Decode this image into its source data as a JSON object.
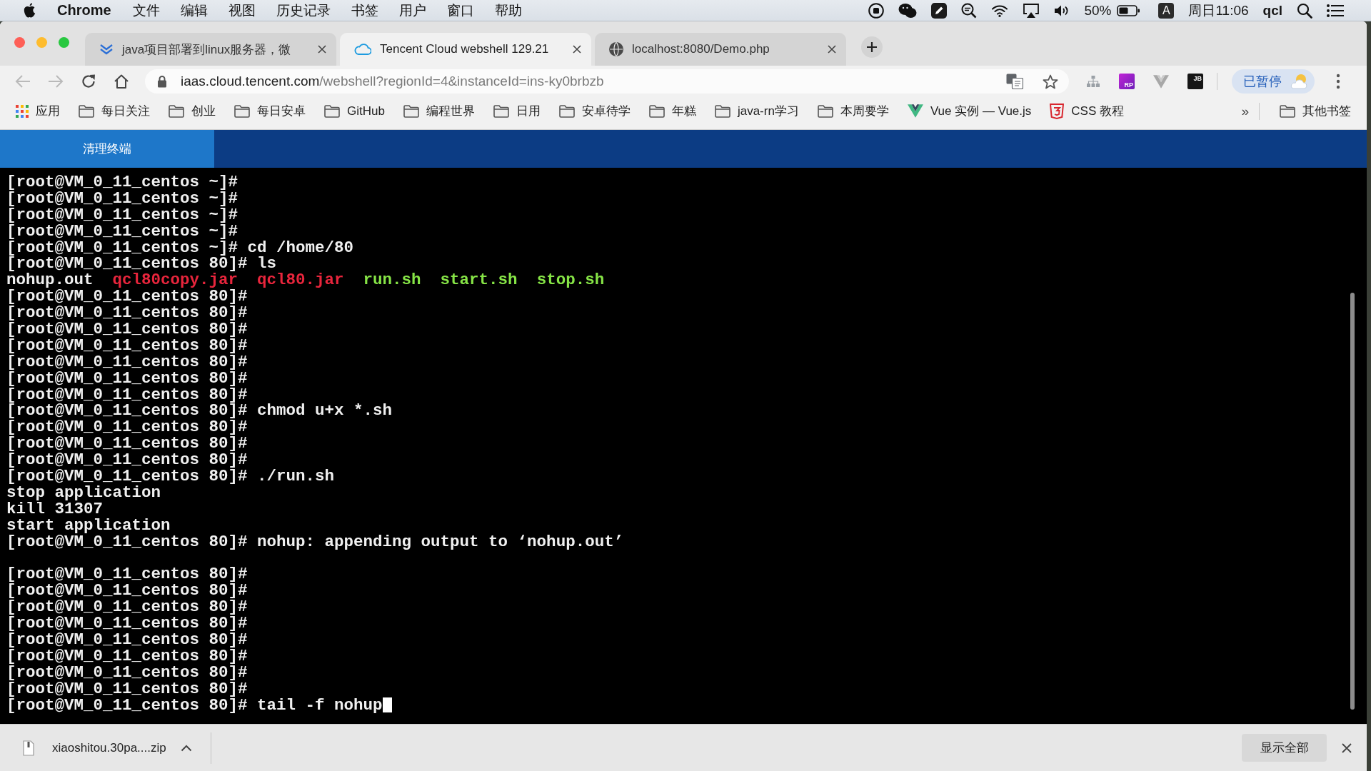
{
  "menu_bar": {
    "app_name": "Chrome",
    "menus": [
      "文件",
      "编辑",
      "视图",
      "历史记录",
      "书签",
      "用户",
      "窗口",
      "帮助"
    ],
    "status": {
      "battery": "50%",
      "input_source": "A",
      "clock": "周日11:06",
      "user": "qcl"
    }
  },
  "tabs": [
    {
      "title": "java项目部署到linux服务器，微",
      "kind": "chevrons",
      "selected": false
    },
    {
      "title": "Tencent Cloud webshell 129.21",
      "kind": "cloud",
      "selected": true
    },
    {
      "title": "localhost:8080/Demo.php",
      "kind": "globe",
      "selected": false
    }
  ],
  "nav_buttons": [
    {
      "kind": "back",
      "disabled": true
    },
    {
      "kind": "forward",
      "disabled": true
    },
    {
      "kind": "reload",
      "disabled": false
    },
    {
      "kind": "home",
      "disabled": false
    }
  ],
  "address_bar": {
    "host": "iaas.cloud.tencent.com",
    "path": "/webshell?regionId=4&instanceId=ins-ky0brbzb"
  },
  "extensions": [
    {
      "kind": "sitemap"
    },
    {
      "kind": "rp",
      "label": "RP"
    },
    {
      "kind": "vue"
    },
    {
      "kind": "jb",
      "label": "JB"
    }
  ],
  "profile_button": {
    "label": "已暂停"
  },
  "bookmarks": [
    {
      "kind": "apps",
      "label": "应用"
    },
    {
      "kind": "folder",
      "label": "每日关注"
    },
    {
      "kind": "folder",
      "label": "创业"
    },
    {
      "kind": "folder",
      "label": "每日安卓"
    },
    {
      "kind": "folder",
      "label": "GitHub"
    },
    {
      "kind": "folder",
      "label": "编程世界"
    },
    {
      "kind": "folder",
      "label": "日用"
    },
    {
      "kind": "folder",
      "label": "安卓待学"
    },
    {
      "kind": "folder",
      "label": "年糕"
    },
    {
      "kind": "folder",
      "label": "java-rn学习"
    },
    {
      "kind": "folder",
      "label": "本周要学"
    },
    {
      "kind": "vue",
      "label": "Vue 实例 — Vue.js"
    },
    {
      "kind": "css",
      "label": "CSS 教程"
    }
  ],
  "bookmarks_overflow": "»",
  "other_bookmarks": {
    "kind": "folder",
    "label": "其他书签"
  },
  "terminal_toolbar": {
    "clear_button": "清理终端"
  },
  "terminal": {
    "lines": [
      {
        "kind": "text",
        "text": "[root@VM_0_11_centos ~]#"
      },
      {
        "kind": "text",
        "text": "[root@VM_0_11_centos ~]#"
      },
      {
        "kind": "text",
        "text": "[root@VM_0_11_centos ~]#"
      },
      {
        "kind": "text",
        "text": "[root@VM_0_11_centos ~]#"
      },
      {
        "kind": "text",
        "text": "[root@VM_0_11_centos ~]# cd /home/80"
      },
      {
        "kind": "text",
        "text": "[root@VM_0_11_centos 80]# ls"
      },
      {
        "kind": "listing",
        "files": [
          {
            "name": "nohup.out",
            "color": "#f0f0f0"
          },
          {
            "name": "qcl80copy.jar",
            "color": "#e8253c"
          },
          {
            "name": "qcl80.jar",
            "color": "#e8253c"
          },
          {
            "name": "run.sh",
            "color": "#86e446"
          },
          {
            "name": "start.sh",
            "color": "#86e446"
          },
          {
            "name": "stop.sh",
            "color": "#86e446"
          }
        ]
      },
      {
        "kind": "text",
        "text": "[root@VM_0_11_centos 80]#"
      },
      {
        "kind": "text",
        "text": "[root@VM_0_11_centos 80]#"
      },
      {
        "kind": "text",
        "text": "[root@VM_0_11_centos 80]#"
      },
      {
        "kind": "text",
        "text": "[root@VM_0_11_centos 80]#"
      },
      {
        "kind": "text",
        "text": "[root@VM_0_11_centos 80]#"
      },
      {
        "kind": "text",
        "text": "[root@VM_0_11_centos 80]#"
      },
      {
        "kind": "text",
        "text": "[root@VM_0_11_centos 80]#"
      },
      {
        "kind": "text",
        "text": "[root@VM_0_11_centos 80]# chmod u+x *.sh"
      },
      {
        "kind": "text",
        "text": "[root@VM_0_11_centos 80]#"
      },
      {
        "kind": "text",
        "text": "[root@VM_0_11_centos 80]#"
      },
      {
        "kind": "text",
        "text": "[root@VM_0_11_centos 80]#"
      },
      {
        "kind": "text",
        "text": "[root@VM_0_11_centos 80]# ./run.sh"
      },
      {
        "kind": "text",
        "text": "stop application"
      },
      {
        "kind": "text",
        "text": "kill 31307"
      },
      {
        "kind": "text",
        "text": "start application"
      },
      {
        "kind": "text",
        "text": "[root@VM_0_11_centos 80]# nohup: appending output to ‘nohup.out’"
      },
      {
        "kind": "blank"
      },
      {
        "kind": "text",
        "text": "[root@VM_0_11_centos 80]#"
      },
      {
        "kind": "text",
        "text": "[root@VM_0_11_centos 80]#"
      },
      {
        "kind": "text",
        "text": "[root@VM_0_11_centos 80]#"
      },
      {
        "kind": "text",
        "text": "[root@VM_0_11_centos 80]#"
      },
      {
        "kind": "text",
        "text": "[root@VM_0_11_centos 80]#"
      },
      {
        "kind": "text",
        "text": "[root@VM_0_11_centos 80]#"
      },
      {
        "kind": "text",
        "text": "[root@VM_0_11_centos 80]#"
      },
      {
        "kind": "text",
        "text": "[root@VM_0_11_centos 80]#"
      },
      {
        "kind": "text",
        "text": "[root@VM_0_11_centos 80]# tail -f nohup"
      }
    ],
    "cursor_visible": true
  },
  "download_bar": {
    "items": [
      {
        "filename": "xiaoshitou.30pa....zip"
      }
    ],
    "show_all": "显示全部"
  }
}
